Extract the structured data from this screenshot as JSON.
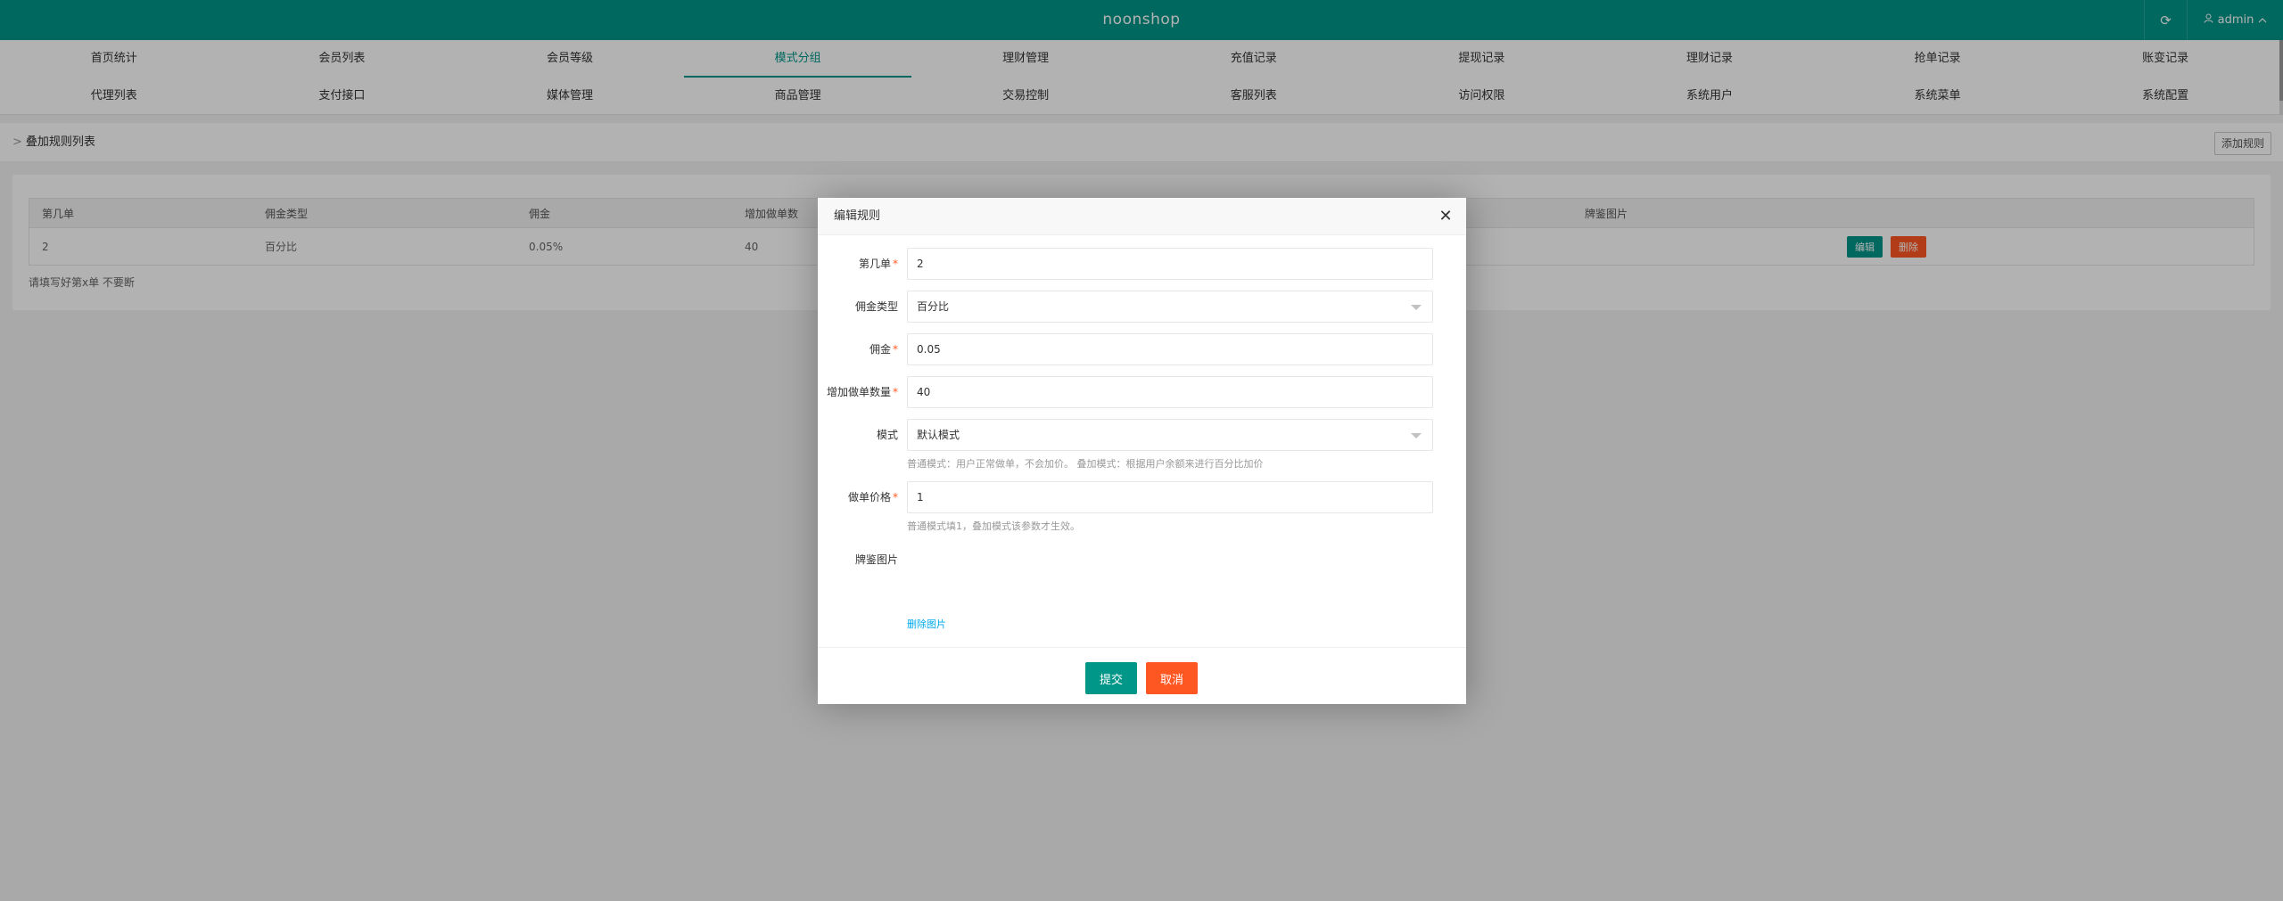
{
  "header": {
    "brand": "noonshop",
    "refresh_icon": "refresh-icon",
    "user_name": "admin"
  },
  "nav": {
    "row1": [
      "首页统计",
      "会员列表",
      "会员等级",
      "模式分组",
      "理财管理",
      "充值记录",
      "提现记录",
      "理财记录",
      "抢单记录",
      "账变记录"
    ],
    "row2": [
      "代理列表",
      "支付接口",
      "媒体管理",
      "商品管理",
      "交易控制",
      "客服列表",
      "访问权限",
      "系统用户",
      "系统菜单",
      "系统配置"
    ],
    "active": "模式分组"
  },
  "page": {
    "breadcrumb_arrow": ">",
    "breadcrumb": "叠加规则列表",
    "add_button": "添加规则"
  },
  "table": {
    "headers": [
      "第几单",
      "佣金类型",
      "佣金",
      "增加做单数",
      "",
      "牌鉴图片",
      ""
    ],
    "rows": [
      {
        "c1": "2",
        "c2": "百分比",
        "c3": "0.05%",
        "c4": "40",
        "edit": "编辑",
        "delete": "删除"
      }
    ],
    "note": "请填写好第x单 不要断"
  },
  "modal": {
    "title": "编辑规则",
    "fields": {
      "order_no_label": "第几单",
      "order_no_value": "2",
      "commission_type_label": "佣金类型",
      "commission_type_value": "百分比",
      "commission_label": "佣金",
      "commission_value": "0.05",
      "add_count_label": "增加做单数量",
      "add_count_value": "40",
      "mode_label": "模式",
      "mode_value": "默认模式",
      "mode_hint": "普通模式：用户正常做单，不会加价。 叠加模式：根据用户余额来进行百分比加价",
      "price_label": "做单价格",
      "price_value": "1",
      "price_hint": "普通模式填1，叠加模式该参数才生效。",
      "image_label": "牌鉴图片",
      "delete_image": "删除图片"
    },
    "submit": "提交",
    "cancel": "取消"
  },
  "colors": {
    "primary": "#009688",
    "danger": "#ff5722",
    "link": "#01aaed"
  }
}
